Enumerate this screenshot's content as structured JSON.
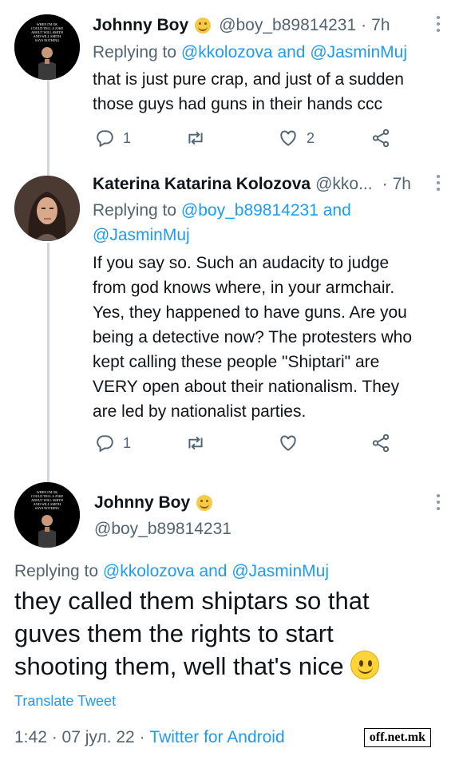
{
  "tweet1": {
    "name": "Johnny Boy",
    "handle": "@boy_b89814231",
    "dot": "·",
    "time": "7h",
    "replying_prefix": "Replying to ",
    "replying_links": "@kkolozova and @JasminMuj",
    "text_line1": "that is just pure crap, and just of a sudden",
    "text_line2": "those guys had guns in their hands ccc",
    "reply_count": "1",
    "retweet_count": "",
    "like_count": "2",
    "avatar_text": [
      "WHEN I'M OK",
      "COULD TELL A JOKE",
      "ABOUT WILL SMITH",
      "AND WILL SMITH",
      "SAYS NOTHING"
    ],
    "icons": {
      "reply": "reply-icon",
      "retweet": "retweet-icon",
      "like": "heart-icon",
      "share": "share-icon",
      "badge": "emoji-badge-icon",
      "more": "more-icon"
    }
  },
  "tweet2": {
    "name": "Katerina Katarina Kolozova",
    "handle": "@kko...",
    "dot": "·",
    "time": "7h",
    "replying_prefix": "Replying to ",
    "replying_link1": "@boy_b89814231 and",
    "replying_link2": "@JasminMuj",
    "text_lines": [
      "If you say so. Such an audacity to judge",
      "from god knows where, in your armchair.",
      "Yes, they happened to have guns. Are you",
      "being a detective now? The protesters who",
      "kept calling these people \"Shiptari\" are",
      "VERY open about their nationalism. They",
      "are led by nationalist parties."
    ],
    "reply_count": "1"
  },
  "main": {
    "name": "Johnny Boy",
    "handle": "@boy_b89814231",
    "replying_prefix": "Replying to ",
    "replying_links": "@kkolozova and @JasminMuj",
    "text_line1": "they called them shiptars so that",
    "text_line2": "guves them the rights to start",
    "text_line3": "shooting them, well that's nice",
    "translate": "Translate Tweet",
    "time": "1:42",
    "date": "07 јул. 22",
    "source": "Twitter for Android",
    "sep": " · "
  },
  "watermark": "off.net.mk",
  "colors": {
    "link": "#1d9bf0",
    "muted": "#536471",
    "text": "#0f1419",
    "thread_line": "#cfd9de"
  }
}
